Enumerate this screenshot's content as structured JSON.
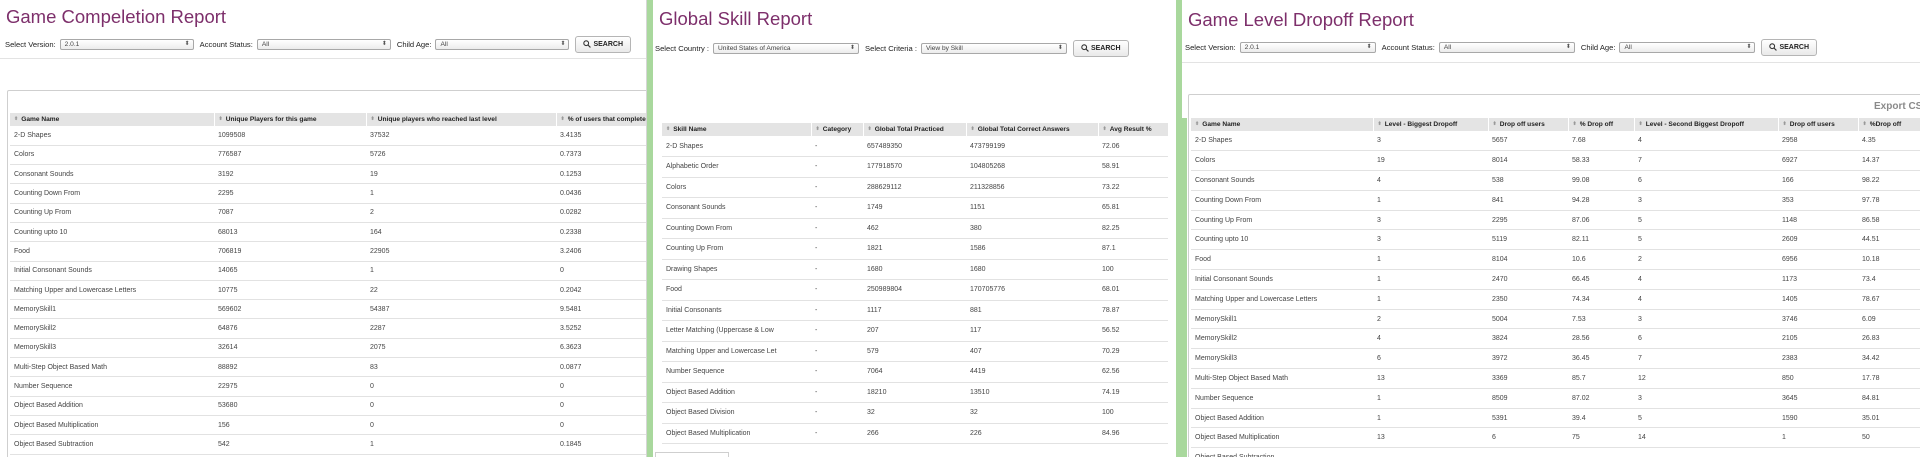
{
  "completion": {
    "title": "Game Compeletion Report",
    "filters": {
      "version_label": "Select Version:",
      "version_value": "2.0.1",
      "status_label": "Account Status:",
      "status_value": "All",
      "age_label": "Child Age:",
      "age_value": "All",
      "search_label": "SEARCH"
    },
    "columns": [
      "Game Name",
      "Unique Players for this game",
      "Unique players who reached last level",
      "% of users that completed g"
    ],
    "rows": [
      [
        "2-D Shapes",
        "1099508",
        "37532",
        "3.4135"
      ],
      [
        "Colors",
        "776587",
        "5726",
        "0.7373"
      ],
      [
        "Consonant Sounds",
        "3192",
        "19",
        "0.1253"
      ],
      [
        "Counting Down From",
        "2295",
        "1",
        "0.0436"
      ],
      [
        "Counting Up From",
        "7087",
        "2",
        "0.0282"
      ],
      [
        "Counting upto 10",
        "68013",
        "164",
        "0.2338"
      ],
      [
        "Food",
        "706819",
        "22905",
        "3.2406"
      ],
      [
        "Initial Consonant Sounds",
        "14065",
        "1",
        "0"
      ],
      [
        "Matching Upper and Lowercase Letters",
        "10775",
        "22",
        "0.2042"
      ],
      [
        "MemorySkill1",
        "569602",
        "54387",
        "9.5481"
      ],
      [
        "MemorySkill2",
        "64876",
        "2287",
        "3.5252"
      ],
      [
        "MemorySkill3",
        "32614",
        "2075",
        "6.3623"
      ],
      [
        "Multi-Step Object Based Math",
        "88892",
        "83",
        "0.0877"
      ],
      [
        "Number Sequence",
        "22975",
        "0",
        "0"
      ],
      [
        "Object Based Addition",
        "53680",
        "0",
        "0"
      ],
      [
        "Object Based Multiplication",
        "156",
        "0",
        "0"
      ],
      [
        "Object Based Subtraction",
        "542",
        "1",
        "0.1845"
      ]
    ]
  },
  "skill": {
    "title": "Global Skill Report",
    "filters": {
      "country_label": "Select Country :",
      "country_value": "United States of America",
      "criteria_label": "Select Criteria :",
      "criteria_value": "View by Skill",
      "search_label": "SEARCH"
    },
    "columns": [
      "Skill Name",
      "Category",
      "Global Total Practiced",
      "Global Total Correct Answers",
      "Avg Result %"
    ],
    "rows": [
      [
        "2-D Shapes",
        "-",
        "657489350",
        "473799199",
        "72.06"
      ],
      [
        "Alphabetic Order",
        "-",
        "177918570",
        "104805268",
        "58.91"
      ],
      [
        "Colors",
        "-",
        "288629112",
        "211328856",
        "73.22"
      ],
      [
        "Consonant Sounds",
        "-",
        "1749",
        "1151",
        "65.81"
      ],
      [
        "Counting Down From",
        "-",
        "462",
        "380",
        "82.25"
      ],
      [
        "Counting Up From",
        "-",
        "1821",
        "1586",
        "87.1"
      ],
      [
        "Drawing Shapes",
        "-",
        "1680",
        "1680",
        "100"
      ],
      [
        "Food",
        "-",
        "250989804",
        "170705776",
        "68.01"
      ],
      [
        "Initial Consonants",
        "-",
        "1117",
        "881",
        "78.87"
      ],
      [
        "Letter Matching (Uppercase & Low",
        "-",
        "207",
        "117",
        "56.52"
      ],
      [
        "Matching Upper and Lowercase Let",
        "-",
        "579",
        "407",
        "70.29"
      ],
      [
        "Number Sequence",
        "-",
        "7064",
        "4419",
        "62.56"
      ],
      [
        "Object Based Addition",
        "-",
        "18210",
        "13510",
        "74.19"
      ],
      [
        "Object Based Division",
        "-",
        "32",
        "32",
        "100"
      ],
      [
        "Object Based Multiplication",
        "-",
        "266",
        "226",
        "84.96"
      ]
    ]
  },
  "dropoff": {
    "title": "Game Level Dropoff Report",
    "filters": {
      "version_label": "Select Version:",
      "version_value": "2.0.1",
      "status_label": "Account Status:",
      "status_value": "All",
      "age_label": "Child Age:",
      "age_value": "All",
      "search_label": "SEARCH"
    },
    "export_label": "Export CSV",
    "columns": [
      "Game Name",
      "Level - Biggest Dropoff",
      "Drop off users",
      "% Drop off",
      "Level - Second Biggest Dropoff",
      "Drop off users",
      "%Drop off"
    ],
    "rows": [
      [
        "2-D Shapes",
        "3",
        "5657",
        "7.68",
        "4",
        "2958",
        "4.35"
      ],
      [
        "Colors",
        "19",
        "8014",
        "58.33",
        "7",
        "6927",
        "14.37"
      ],
      [
        "Consonant Sounds",
        "4",
        "538",
        "99.08",
        "6",
        "166",
        "98.22"
      ],
      [
        "Counting Down From",
        "1",
        "841",
        "94.28",
        "3",
        "353",
        "97.78"
      ],
      [
        "Counting Up From",
        "3",
        "2295",
        "87.06",
        "5",
        "1148",
        "86.58"
      ],
      [
        "Counting upto 10",
        "3",
        "5119",
        "82.11",
        "5",
        "2609",
        "44.51"
      ],
      [
        "Food",
        "1",
        "8104",
        "10.6",
        "2",
        "6956",
        "10.18"
      ],
      [
        "Initial Consonant Sounds",
        "1",
        "2470",
        "66.45",
        "4",
        "1173",
        "73.4"
      ],
      [
        "Matching Upper and Lowercase Letters",
        "1",
        "2350",
        "74.34",
        "4",
        "1405",
        "78.67"
      ],
      [
        "MemorySkill1",
        "2",
        "5004",
        "7.53",
        "3",
        "3746",
        "6.09"
      ],
      [
        "MemorySkill2",
        "4",
        "3824",
        "28.56",
        "6",
        "2105",
        "26.83"
      ],
      [
        "MemorySkill3",
        "6",
        "3972",
        "36.45",
        "7",
        "2383",
        "34.42"
      ],
      [
        "Multi-Step Object Based Math",
        "13",
        "3369",
        "85.7",
        "12",
        "850",
        "17.78"
      ],
      [
        "Number Sequence",
        "1",
        "8509",
        "87.02",
        "3",
        "3645",
        "84.81"
      ],
      [
        "Object Based Addition",
        "1",
        "5391",
        "39.4",
        "5",
        "1590",
        "35.01"
      ],
      [
        "Object Based Multiplication",
        "13",
        "6",
        "75",
        "14",
        "1",
        "50"
      ],
      [
        "Object Based Subtraction",
        "",
        "",
        "",
        "",
        "",
        ""
      ]
    ]
  }
}
